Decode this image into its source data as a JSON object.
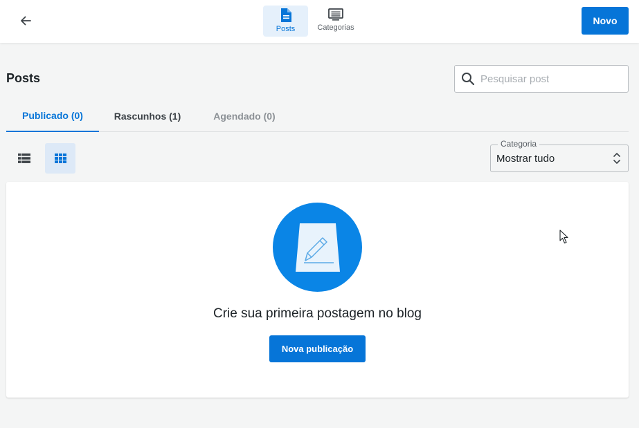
{
  "header": {
    "nav_tabs": [
      {
        "label": "Posts",
        "icon": "document-icon",
        "active": true
      },
      {
        "label": "Categorias",
        "icon": "categories-icon",
        "active": false
      }
    ],
    "new_button_label": "Novo"
  },
  "page": {
    "title": "Posts",
    "search": {
      "placeholder": "Pesquisar post",
      "value": ""
    }
  },
  "tabs": [
    {
      "label": "Publicado (0)",
      "active": true
    },
    {
      "label": "Rascunhos (1)",
      "active": false
    },
    {
      "label": "Agendado (0)",
      "active": false
    }
  ],
  "view_toggle": {
    "active": "grid"
  },
  "category_filter": {
    "label": "Categoria",
    "selected": "Mostrar tudo"
  },
  "empty_state": {
    "message": "Crie sua primeira postagem no blog",
    "button_label": "Nova publicação"
  },
  "colors": {
    "accent": "#0675d8",
    "accent_light": "#e5f0fb",
    "background": "#f4f5f5",
    "card": "#ffffff"
  }
}
